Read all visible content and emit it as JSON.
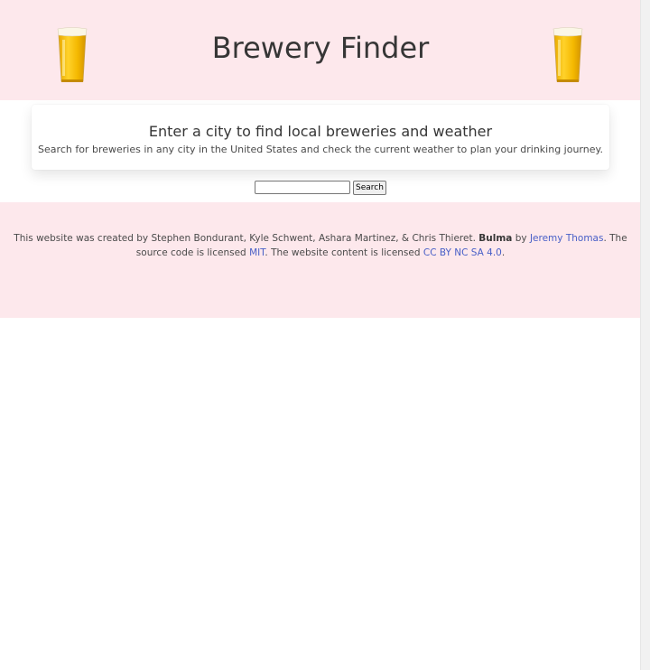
{
  "header": {
    "title": "Brewery Finder",
    "left_icon": "beer-glass-icon",
    "right_icon": "beer-glass-icon"
  },
  "card": {
    "heading": "Enter a city to find local breweries and weather",
    "subheading": "Search for breweries in any city in the United States and check the current weather to plan your drinking journey."
  },
  "search": {
    "value": "",
    "button_label": "Search"
  },
  "footer": {
    "text_before": "This website was created by Stephen Bondurant, Kyle Schwent, Ashara Martinez, & Chris Thieret.",
    "brand": "Bulma",
    "by_word": "by",
    "author_link": "Jeremy Thomas",
    "source_text": ". The source code is licensed",
    "license_link": "MIT",
    "content_text": ". The website content is licensed",
    "content_license_link": "CC BY NC SA 4.0",
    "end": "."
  },
  "colors": {
    "hero_bg": "#fde8ec",
    "footer_bg": "#fde8ec",
    "link": "#485fc7",
    "title": "#363636"
  }
}
